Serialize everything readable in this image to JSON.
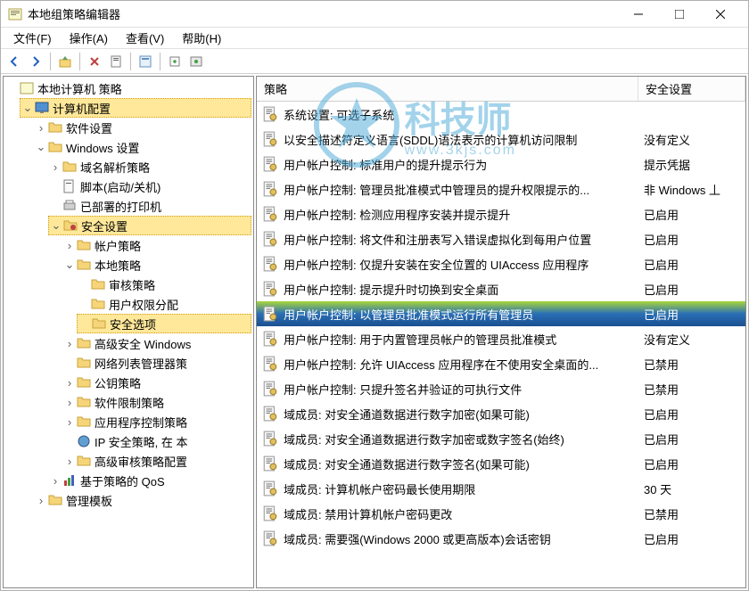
{
  "window": {
    "title": "本地组策略编辑器"
  },
  "menubar": [
    {
      "label": "文件(F)"
    },
    {
      "label": "操作(A)"
    },
    {
      "label": "查看(V)"
    },
    {
      "label": "帮助(H)"
    }
  ],
  "tree": {
    "root_label": "本地计算机 策略",
    "computer_config": "计算机配置",
    "nodes": {
      "software_settings": "软件设置",
      "windows_settings": "Windows 设置",
      "dns_policy": "域名解析策略",
      "scripts": "脚本(启动/关机)",
      "deployed_printers": "已部署的打印机",
      "security_settings": "安全设置",
      "account_policy": "帐户策略",
      "local_policy": "本地策略",
      "audit_policy": "审核策略",
      "user_rights": "用户权限分配",
      "security_options": "安全选项",
      "adv_security_windows": "高级安全 Windows",
      "network_list_manager": "网络列表管理器策",
      "public_key": "公钥策略",
      "software_restriction": "软件限制策略",
      "app_control": "应用程序控制策略",
      "ip_security": "IP 安全策略, 在 本",
      "adv_audit": "高级审核策略配置",
      "qos": "基于策略的 QoS",
      "admin_templates": "管理模板"
    }
  },
  "list": {
    "columns": {
      "policy": "策略",
      "setting": "安全设置"
    },
    "items": [
      {
        "policy": "系统设置: 可选子系统",
        "setting": ""
      },
      {
        "policy": "以安全描述符定义语言(SDDL)语法表示的计算机访问限制",
        "setting": "没有定义"
      },
      {
        "policy": "用户帐户控制: 标准用户的提升提示行为",
        "setting": "提示凭据"
      },
      {
        "policy": "用户帐户控制: 管理员批准模式中管理员的提升权限提示的...",
        "setting": "非 Windows 丄"
      },
      {
        "policy": "用户帐户控制: 检测应用程序安装并提示提升",
        "setting": "已启用"
      },
      {
        "policy": "用户帐户控制: 将文件和注册表写入错误虚拟化到每用户位置",
        "setting": "已启用"
      },
      {
        "policy": "用户帐户控制: 仅提升安装在安全位置的 UIAccess 应用程序",
        "setting": "已启用"
      },
      {
        "policy": "用户帐户控制: 提示提升时切换到安全桌面",
        "setting": "已启用"
      },
      {
        "policy": "用户帐户控制: 以管理员批准模式运行所有管理员",
        "setting": "已启用",
        "highlighted": true
      },
      {
        "policy": "用户帐户控制: 用于内置管理员帐户的管理员批准模式",
        "setting": "没有定义"
      },
      {
        "policy": "用户帐户控制: 允许 UIAccess 应用程序在不使用安全桌面的...",
        "setting": "已禁用"
      },
      {
        "policy": "用户帐户控制: 只提升签名并验证的可执行文件",
        "setting": "已禁用"
      },
      {
        "policy": "域成员: 对安全通道数据进行数字加密(如果可能)",
        "setting": "已启用"
      },
      {
        "policy": "域成员: 对安全通道数据进行数字加密或数字签名(始终)",
        "setting": "已启用"
      },
      {
        "policy": "域成员: 对安全通道数据进行数字签名(如果可能)",
        "setting": "已启用"
      },
      {
        "policy": "域成员: 计算机帐户密码最长使用期限",
        "setting": "30 天"
      },
      {
        "policy": "域成员: 禁用计算机帐户密码更改",
        "setting": "已禁用"
      },
      {
        "policy": "域成员: 需要强(Windows 2000 或更高版本)会话密钥",
        "setting": "已启用"
      }
    ]
  },
  "watermark": {
    "title": "科技师",
    "subtitle": "www.3kjs.com"
  }
}
